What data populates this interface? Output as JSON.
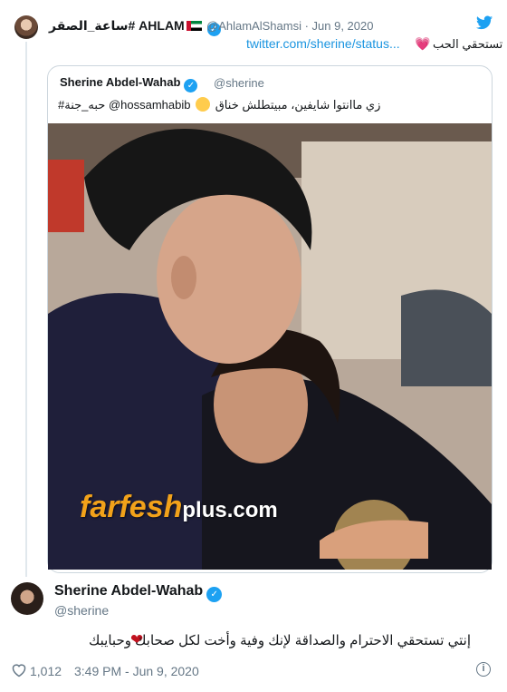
{
  "header": {
    "display_name": "ساعة_الصقر# AHLAM",
    "handle": "@AhlamAlShamsi",
    "date": "· Jun 9, 2020",
    "link": "twitter.com/sherine/status...",
    "text": "تستحقي الحب",
    "verified_mark": "✓"
  },
  "quoted": {
    "name": "Sherine Abdel-Wahab",
    "handle": "@sherine",
    "text": "زي ماانتوا شايفين، مبيتطلش خناق",
    "text_tag": "#حبه_جنة @hossamhabib",
    "verified_mark": "✓"
  },
  "photo": {
    "watermark_main": "farfesh",
    "watermark_plus": "plus.com"
  },
  "tweet": {
    "name": "Sherine Abdel-Wahab",
    "handle": "@sherine",
    "text": "إنتي تستحقي الاحترام والصداقة لإنك وفية وأخت لكل صحابك وحبايبك",
    "verified_mark": "✓",
    "heart": "❤"
  },
  "footer": {
    "likes": "1,012",
    "timestamp": "3:49 PM - Jun 9, 2020",
    "info": "i"
  },
  "colors": {
    "twitter_blue": "#1da1f2",
    "link_blue": "#1b95e0",
    "gray": "#657786",
    "watermark_orange": "#f2a21a"
  },
  "icons": [
    "twitter-bird-icon",
    "verified-icon",
    "heart-outline-icon",
    "info-icon"
  ]
}
